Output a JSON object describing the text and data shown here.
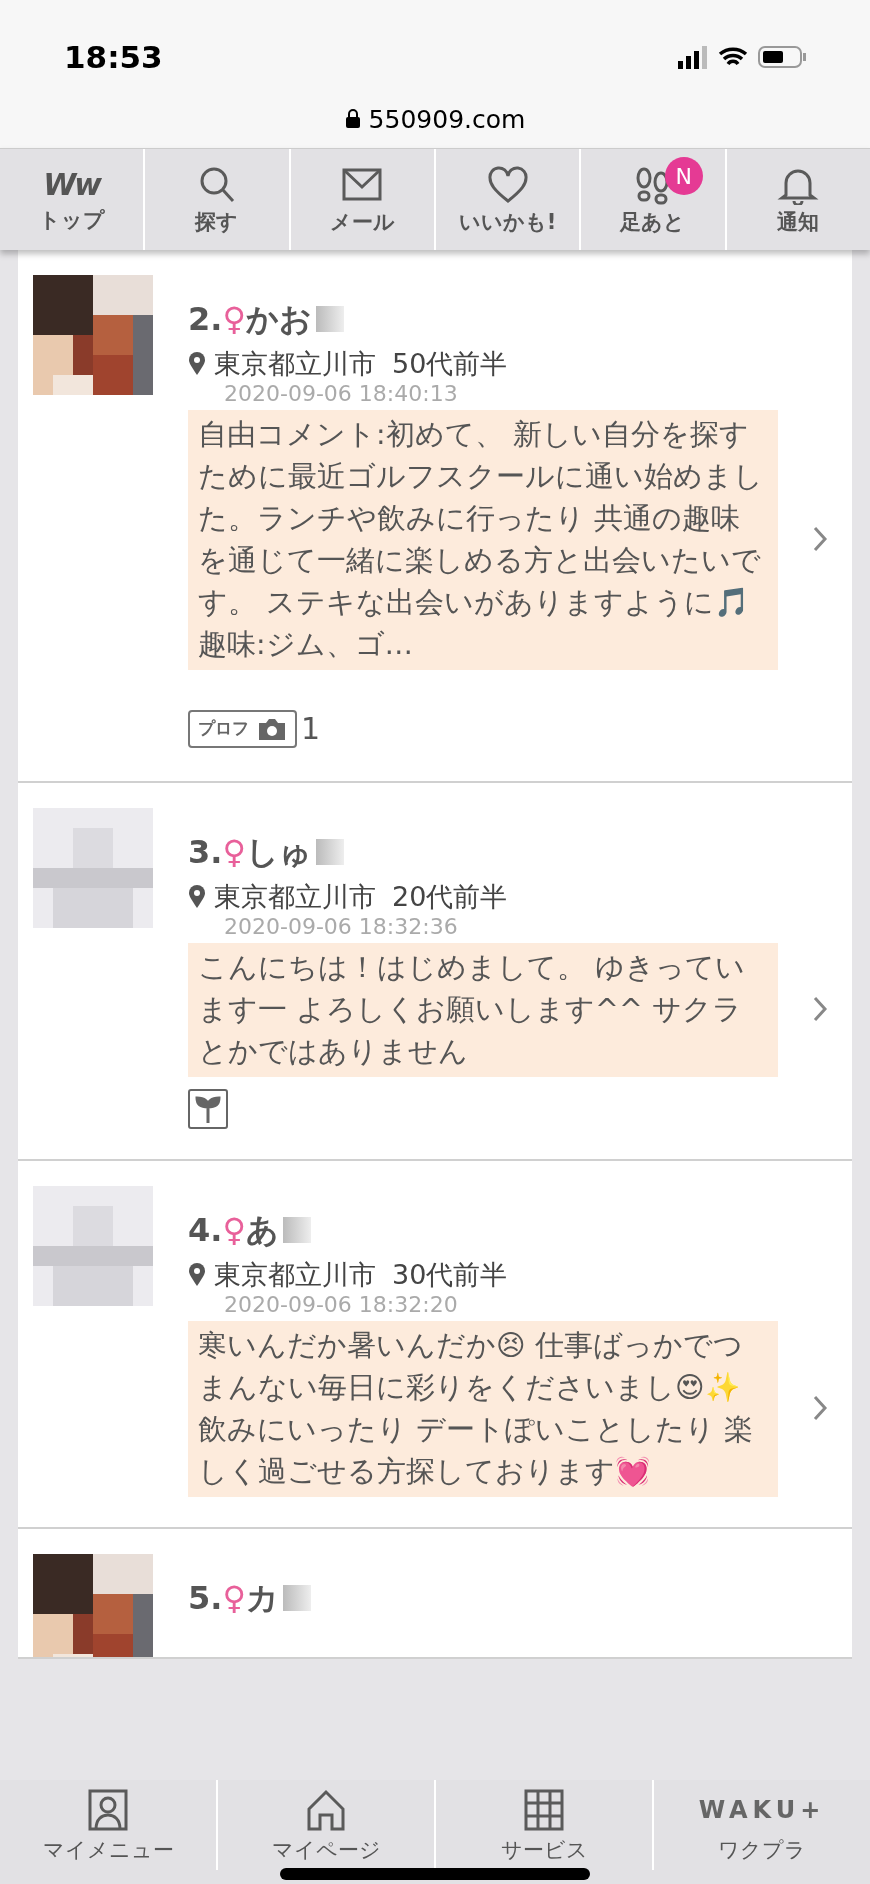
{
  "status_bar": {
    "time": "18:53",
    "url": "550909.com"
  },
  "top_nav": [
    {
      "kind": "logo",
      "logo_text": "Ww",
      "label": "トップ"
    },
    {
      "kind": "search",
      "label": "探す"
    },
    {
      "kind": "mail",
      "label": "メール"
    },
    {
      "kind": "heart",
      "label": "いいかも!"
    },
    {
      "kind": "footprints",
      "label": "足あと",
      "badge": "N"
    },
    {
      "kind": "bell",
      "label": "通知"
    }
  ],
  "profiles": [
    {
      "number": "2.",
      "gender": "♀",
      "name": "かお",
      "location": "東京都立川市",
      "age": "50代前半",
      "date": "2020-09-06 18:40:13",
      "comment": "自由コメント:初めて、 新しい自分を探すために最近ゴルフスクールに通い始めました。ランチや飲みに行ったり 共通の趣味を通じて一緒に楽しめる方と出会いたいです。 ステキな出会いがありますように🎵 趣味:ジム、ゴ…",
      "tag": {
        "label": "プロフ",
        "count": "1"
      }
    },
    {
      "avatar": {
        "kind": "placeholder"
      },
      "number": "3.",
      "gender": "♀",
      "name": "しゅ",
      "location": "東京都立川市",
      "age": "20代前半",
      "date": "2020-09-06 18:32:36",
      "comment": "こんにちは！はじめまして。 ゆきっています一 よろしくお願いします^^ サクラとかではありません",
      "tag": {
        "kind": "sprout"
      }
    },
    {
      "avatar": {
        "kind": "placeholder"
      },
      "number": "4.",
      "gender": "♀",
      "name": "あ",
      "location": "東京都立川市",
      "age": "30代前半",
      "date": "2020-09-06 18:32:20",
      "comment": "寒いんだか暑いんだか😣 仕事ばっかでつまんない毎日に彩りをくださいまし😍✨飲みにいったり デートぽいことしたり 楽しく過ごせる方探しております💓"
    },
    {
      "number": "5.",
      "gender": "♀",
      "name": "カ"
    }
  ],
  "bottom_nav": [
    {
      "kind": "person",
      "label": "マイメニュー"
    },
    {
      "kind": "home",
      "label": "マイページ"
    },
    {
      "kind": "grid",
      "label": "サービス"
    },
    {
      "kind": "logo",
      "logo_text": "WAKU+",
      "label": "ワクプラ"
    }
  ]
}
